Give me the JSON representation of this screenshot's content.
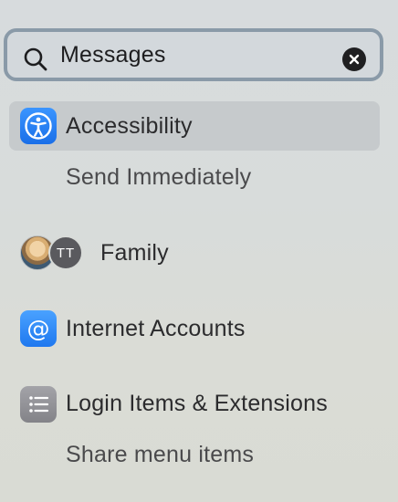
{
  "search": {
    "value": "Messages",
    "search_icon": "magnifier-icon",
    "clear_icon": "clear-x-icon"
  },
  "results": [
    {
      "title": "Accessibility",
      "icon": "accessibility-icon",
      "icon_color": "#1f7cf3",
      "selected": true,
      "subitems": [
        "Send Immediately"
      ]
    },
    {
      "title": "Family",
      "icon": "family-avatars-icon",
      "avatar_initials": "TT",
      "selected": false,
      "subitems": []
    },
    {
      "title": "Internet Accounts",
      "icon": "at-sign-icon",
      "icon_color": "#2a86f5",
      "selected": false,
      "subitems": []
    },
    {
      "title": "Login Items & Extensions",
      "icon": "list-icon",
      "icon_color": "#8e8e93",
      "selected": false,
      "subitems": [
        "Share menu items"
      ]
    }
  ]
}
